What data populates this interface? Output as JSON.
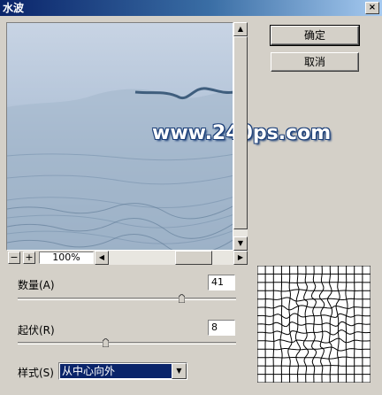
{
  "window": {
    "title": "水波",
    "close_glyph": "×"
  },
  "preview": {
    "watermark": "www.240ps.com",
    "zoom_level": "100%",
    "zoom_out": "−",
    "zoom_in": "+"
  },
  "buttons": {
    "ok": "确定",
    "cancel": "取消"
  },
  "params": {
    "amount_label": "数量(A)",
    "amount_value": "41",
    "amount_fraction": 0.75,
    "ridges_label": "起伏(R)",
    "ridges_value": "8",
    "ridges_fraction": 0.4
  },
  "style": {
    "label": "样式(S)",
    "selected": "从中心向外"
  },
  "colors": {
    "selection": "#0a246a",
    "title_start": "#0a246a",
    "dialog_bg": "#d4d0c8"
  }
}
